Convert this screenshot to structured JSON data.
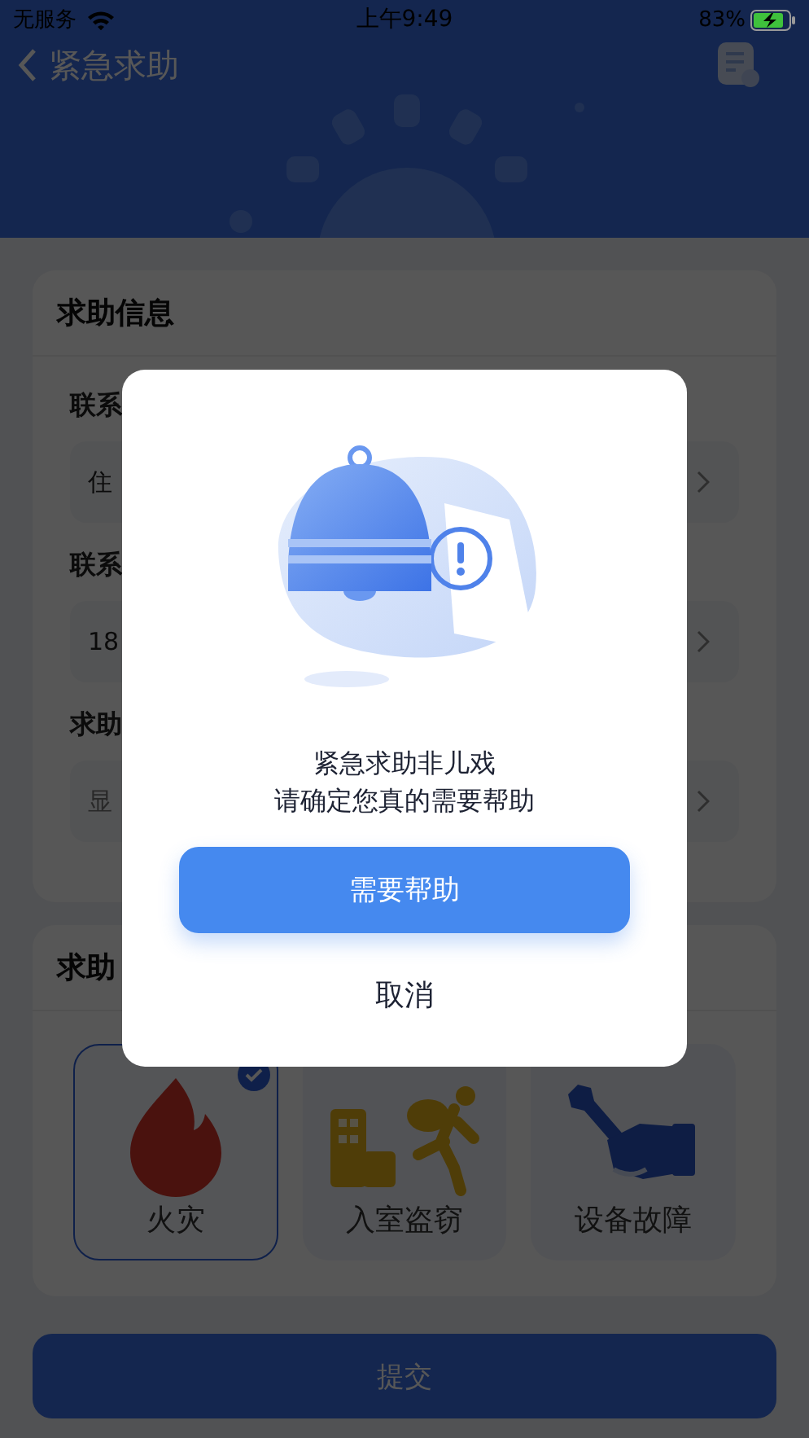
{
  "status_bar": {
    "carrier": "无服务",
    "time": "上午9:49",
    "battery": "83%"
  },
  "nav": {
    "title": "紧急求助"
  },
  "info_card": {
    "title": "求助信息",
    "fields": [
      {
        "label": "联系",
        "value": "住"
      },
      {
        "label": "联系",
        "value": "18"
      },
      {
        "label": "求助",
        "placeholder": "显"
      }
    ]
  },
  "type_card": {
    "title": "求助",
    "types": [
      {
        "kind": "fire",
        "label": "火灾",
        "selected": true
      },
      {
        "kind": "burglary",
        "label": "入室盗窃",
        "selected": false
      },
      {
        "kind": "equipment",
        "label": "设备故障",
        "selected": false
      }
    ]
  },
  "submit_button": "提交",
  "dialog": {
    "message": [
      "紧急求助非儿戏",
      "请确定您真的需要帮助"
    ],
    "confirm_button": "需要帮助",
    "cancel_button": "取消"
  }
}
